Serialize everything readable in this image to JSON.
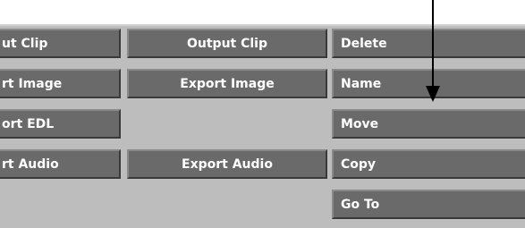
{
  "buttons": {
    "output_clip_left": "ut Clip",
    "export_image_left": "rt Image",
    "export_edl_left": "ort EDL",
    "export_audio_left": "rt Audio",
    "output_clip": "Output Clip",
    "export_image": "Export Image",
    "export_audio": "Export Audio",
    "delete": "Delete",
    "name": "Name",
    "move": "Move",
    "copy": "Copy",
    "go_to": "Go To"
  },
  "icons": {
    "pointer": "down-arrow-icon"
  },
  "colors": {
    "button": "#6a6a6a",
    "panel": "#bdbdbd",
    "text": "#ffffff"
  }
}
